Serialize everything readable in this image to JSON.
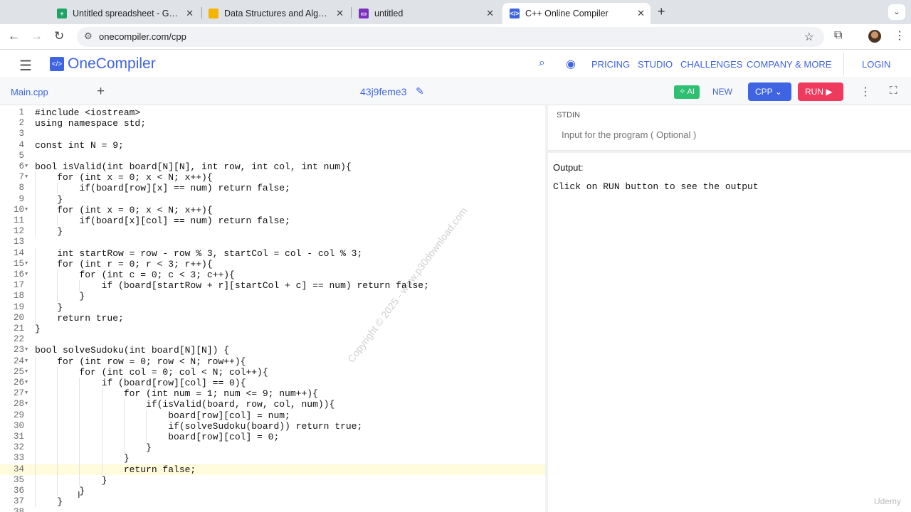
{
  "browser": {
    "tabs": [
      {
        "title": "Untitled spreadsheet - Google Sheets",
        "icon": "sheets-icon",
        "color": "#1fa463"
      },
      {
        "title": "Data Structures and Algorithms",
        "icon": "slides-icon",
        "color": "#f4b400"
      },
      {
        "title": "untitled",
        "icon": "doc-icon",
        "color": "#7b2fbf"
      },
      {
        "title": "C++ Online Compiler",
        "icon": "onecompiler-icon",
        "color": "#3f64e3"
      }
    ],
    "url": "onecompiler.com/cpp"
  },
  "site": {
    "brand": "OneCompiler",
    "logo_mark": "</>",
    "nav": [
      "PRICING",
      "STUDIO",
      "CHALLENGES",
      "COMPANY & MORE"
    ],
    "login": "LOGIN"
  },
  "editor_header": {
    "file_tab": "Main.cpp",
    "project_name": "43j9feme3",
    "ai_label": "AI",
    "new_label": "NEW",
    "lang_label": "CPP",
    "run_label": "RUN"
  },
  "code": {
    "lines": [
      "#include <iostream>",
      "using namespace std;",
      "",
      "const int N = 9;",
      "",
      "bool isValid(int board[N][N], int row, int col, int num){",
      "    for (int x = 0; x < N; x++){",
      "        if(board[row][x] == num) return false;",
      "    }",
      "    for (int x = 0; x < N; x++){",
      "        if(board[x][col] == num) return false;",
      "    }",
      "",
      "    int startRow = row - row % 3, startCol = col - col % 3;",
      "    for (int r = 0; r < 3; r++){",
      "        for (int c = 0; c < 3; c++){",
      "            if (board[startRow + r][startCol + c] == num) return false;",
      "        }",
      "    }",
      "    return true;",
      "}",
      "",
      "bool solveSudoku(int board[N][N]) {",
      "    for (int row = 0; row < N; row++){",
      "        for (int col = 0; col < N; col++){",
      "            if (board[row][col] == 0){",
      "                for (int num = 1; num <= 9; num++){",
      "                    if(isValid(board, row, col, num)){",
      "                        board[row][col] = num;",
      "                        if(solveSudoku(board)) return true;",
      "                        board[row][col] = 0;",
      "                    }",
      "                }",
      "                return false;",
      "            }",
      "        }",
      "    }",
      ""
    ],
    "fold_lines": [
      6,
      7,
      10,
      15,
      16,
      23,
      24,
      25,
      26,
      27,
      28
    ],
    "highlighted_line": 34
  },
  "io": {
    "stdin_label": "STDIN",
    "stdin_placeholder": "Input for the program ( Optional )",
    "output_label": "Output:",
    "output_text": "Click on RUN button to see the output"
  },
  "overlay": {
    "watermark": "Copyright © 2025 - www.p30download.com",
    "udemy": "Udemy"
  }
}
